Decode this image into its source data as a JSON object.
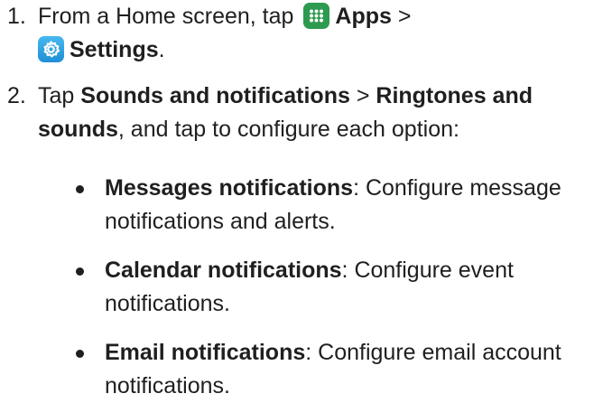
{
  "steps": [
    {
      "number": "1.",
      "prefix": "From a Home screen, tap",
      "apps_label": "Apps",
      "gt": ">",
      "settings_label": "Settings",
      "period": "."
    },
    {
      "number": "2.",
      "tap": "Tap",
      "sounds_label": "Sounds and notifications",
      "gt": ">",
      "ringtones_label_1": "Ringtones and",
      "ringtones_label_2": "sounds",
      "suffix": ", and tap to configure each option:"
    }
  ],
  "options": [
    {
      "title": "Messages notifications",
      "desc_1": ": Configure message",
      "desc_2": "notifications and alerts."
    },
    {
      "title": "Calendar notifications",
      "desc_1": ": Configure event",
      "desc_2": "notifications."
    },
    {
      "title": "Email notifications",
      "desc_1": ": Configure email account",
      "desc_2": "notifications."
    }
  ],
  "icons": {
    "apps": "apps-grid-icon",
    "settings": "settings-gear-icon",
    "apps_color": "#2d9a4f",
    "settings_color": "#2a9ee0"
  }
}
